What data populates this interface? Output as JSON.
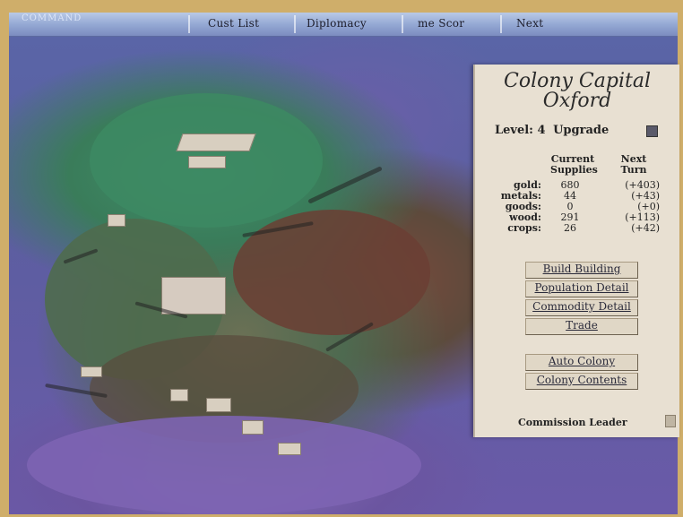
{
  "window": {
    "logo_text": "COMMAND"
  },
  "menu": {
    "items": [
      {
        "label": "Cust List"
      },
      {
        "label": "Diplomacy"
      },
      {
        "label": "me Scor"
      },
      {
        "label": "Next"
      }
    ]
  },
  "colony": {
    "title_line1": "Colony Capital",
    "title_line2": "Oxford",
    "level_label": "Level: 4",
    "upgrade_label": "Upgrade",
    "col_current_1": "Current",
    "col_current_2": "Supplies",
    "col_next_1": "Next",
    "col_next_2": "Turn",
    "rows": [
      {
        "label": "gold:",
        "current": "680",
        "next": "(+403)"
      },
      {
        "label": "metals:",
        "current": "44",
        "next": "(+43)"
      },
      {
        "label": "goods:",
        "current": "0",
        "next": "(+0)"
      },
      {
        "label": "wood:",
        "current": "291",
        "next": "(+113)"
      },
      {
        "label": "crops:",
        "current": "26",
        "next": "(+42)"
      }
    ],
    "buttons": [
      {
        "label": "Build Building"
      },
      {
        "label": "Population Detail"
      },
      {
        "label": "Commodity Detail"
      },
      {
        "label": "Trade"
      },
      {
        "label": "Auto Colony"
      },
      {
        "label": "Colony Contents"
      }
    ],
    "leader_label": "Commission Leader"
  },
  "colors": {
    "menubar": "#95a9d4",
    "panel": "#e8e0d2",
    "frame": "#cfae6a"
  }
}
